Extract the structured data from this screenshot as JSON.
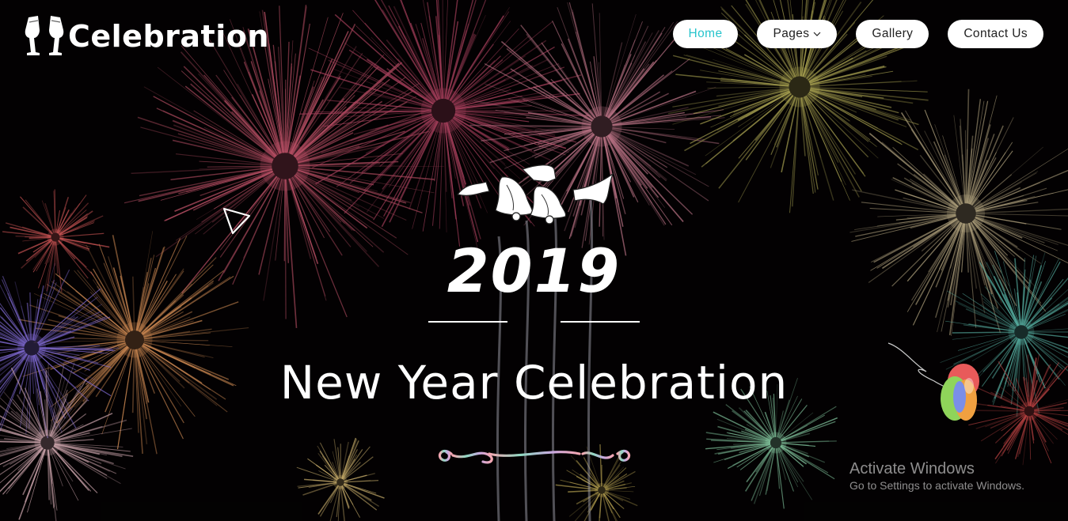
{
  "brand": {
    "name": "Celebration",
    "icon": "champagne-glasses-icon"
  },
  "nav": {
    "items": [
      {
        "label": "Home",
        "active": true
      },
      {
        "label": "Pages",
        "has_dropdown": true
      },
      {
        "label": "Gallery"
      },
      {
        "label": "Contact Us"
      }
    ]
  },
  "hero": {
    "year": "2019",
    "title": "New Year Celebration",
    "decorations": [
      "bells-icon",
      "play-triangle-icon",
      "balloons-icon",
      "swirl-divider"
    ]
  },
  "watermark": {
    "title": "Activate Windows",
    "subtitle": "Go to Settings to activate Windows."
  },
  "colors": {
    "accent": "#27c4cc",
    "nav_bg": "#ffffff",
    "text": "#ffffff",
    "background": "#040203"
  }
}
